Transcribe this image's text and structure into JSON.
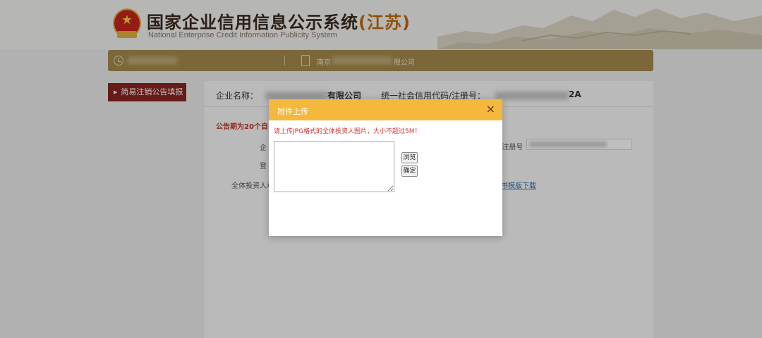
{
  "header": {
    "title": "国家企业信用信息公示系统",
    "province": "(江苏)",
    "subtitle": "National Enterprise Credit Information Publicity System"
  },
  "navbar": {
    "company_prefix": "南京",
    "company_suffix": "限公司",
    "icons": [
      "clock-icon",
      "document-icon"
    ]
  },
  "sidebar": {
    "items": [
      {
        "label": "简易注销公告填报",
        "icon": "caret-right-icon"
      }
    ]
  },
  "main": {
    "company_label": "企业名称：",
    "company_suffix": "有限公司",
    "code_label": "统一社会信用代码/注册号：",
    "code_suffix": "2A",
    "notice": "公告期为20个自",
    "label_a": "企",
    "label_b": "登",
    "label_c": "全体投资人承",
    "label_reg": "/注册号",
    "template_link": "书模版下载"
  },
  "modal": {
    "title": "附件上传",
    "close": "×",
    "hint": "请上传JPG格式的全体投资人图片，大小不超过5M！",
    "browse_label": "浏览",
    "confirm_label": "确定"
  },
  "colors": {
    "navbar_bg": "#a58a4c",
    "sidebar_active_bg": "#8a2420",
    "modal_header_bg": "#f3b83c",
    "hint_text": "#d0342c",
    "link": "#3a6ea5"
  }
}
